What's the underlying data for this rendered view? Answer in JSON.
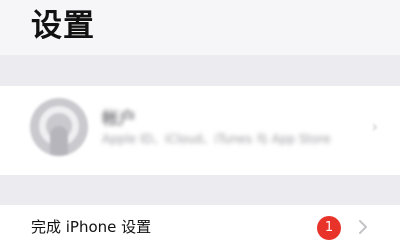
{
  "header": {
    "title": "设置"
  },
  "account": {
    "name": "帐户",
    "subtitle": "Apple ID、iCloud、iTunes 与 App Store",
    "chevron_icon": "chevron-right-icon",
    "avatar_icon": "person-avatar-icon"
  },
  "setup_row": {
    "label": "完成 iPhone 设置",
    "badge_count": "1",
    "badge_color": "#e8332b",
    "chevron_icon": "chevron-right-icon"
  },
  "colors": {
    "background": "#f0f0f4",
    "cell": "#ffffff",
    "separator": "#dcdce0"
  }
}
